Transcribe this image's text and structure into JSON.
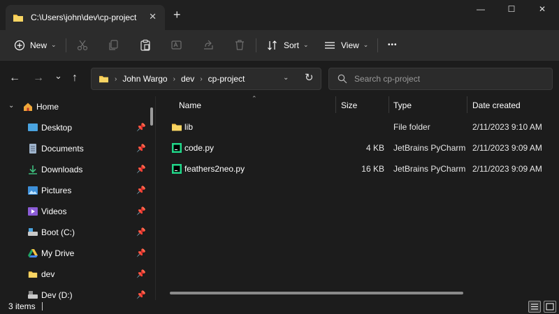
{
  "window": {
    "tab_title": "C:\\Users\\john\\dev\\cp-project",
    "tab_close": "✕",
    "new_tab": "+",
    "minimize": "—",
    "maximize": "☐",
    "close": "✕"
  },
  "toolbar": {
    "new_label": "New",
    "sort_label": "Sort",
    "view_label": "View",
    "more_label": "•••",
    "icons": [
      "plus-circle-icon",
      "cut-icon",
      "copy-icon",
      "paste-icon",
      "rename-icon",
      "share-icon",
      "delete-icon",
      "sort-icon",
      "view-icon"
    ]
  },
  "nav": {
    "back": "←",
    "forward": "→",
    "recent": "⌄",
    "up": "↑",
    "breadcrumb": [
      "John Wargo",
      "dev",
      "cp-project"
    ],
    "refresh": "↻",
    "search_placeholder": "Search cp-project"
  },
  "sidebar": {
    "home": "Home",
    "items": [
      {
        "label": "Desktop",
        "icon": "desktop-icon"
      },
      {
        "label": "Documents",
        "icon": "documents-icon"
      },
      {
        "label": "Downloads",
        "icon": "downloads-icon"
      },
      {
        "label": "Pictures",
        "icon": "pictures-icon"
      },
      {
        "label": "Videos",
        "icon": "videos-icon"
      },
      {
        "label": "Boot (C:)",
        "icon": "drive-icon"
      },
      {
        "label": "My Drive",
        "icon": "google-drive-icon"
      },
      {
        "label": "dev",
        "icon": "folder-icon"
      },
      {
        "label": "Dev (D:)",
        "icon": "drive-icon"
      }
    ]
  },
  "files": {
    "columns": [
      "Name",
      "Size",
      "Type",
      "Date created"
    ],
    "rows": [
      {
        "name": "lib",
        "size": "",
        "type": "File folder",
        "date": "2/11/2023 9:10 AM",
        "icon": "folder-icon"
      },
      {
        "name": "code.py",
        "size": "4 KB",
        "type": "JetBrains PyCharm",
        "date": "2/11/2023 9:09 AM",
        "icon": "pycharm-file-icon"
      },
      {
        "name": "feathers2neo.py",
        "size": "16 KB",
        "type": "JetBrains PyCharm",
        "date": "2/11/2023 9:09 AM",
        "icon": "pycharm-file-icon"
      }
    ]
  },
  "status": {
    "item_count": "3 items"
  },
  "colors": {
    "folder": "#f4c145",
    "accent": "#4aa3df",
    "pycharm_green": "#21d789"
  }
}
